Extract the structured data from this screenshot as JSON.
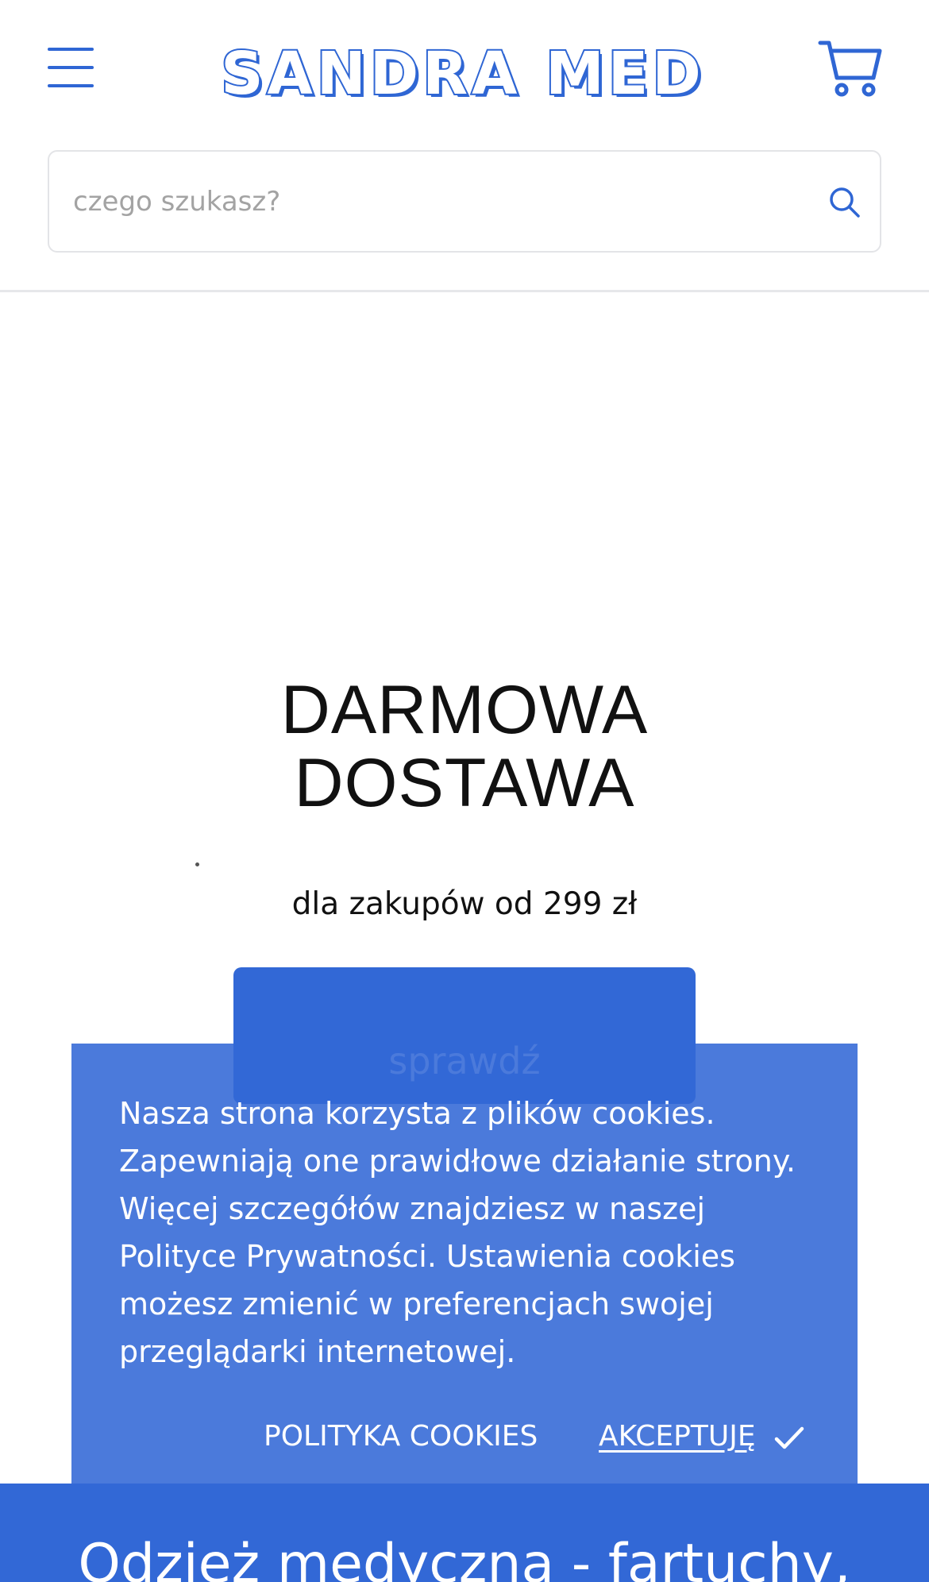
{
  "header": {
    "logo_text": "SANDRA MED",
    "menu_icon": "hamburger-menu-icon",
    "cart_icon": "shopping-cart-icon"
  },
  "search": {
    "placeholder": "czego szukasz?",
    "value": "",
    "icon": "search-icon"
  },
  "hero": {
    "title_line1": "DARMOWA",
    "title_line2": "DOSTAWA",
    "subtitle": "dla zakupów od 299 zł",
    "button_label": "sprawdź"
  },
  "cookie_banner": {
    "text": "Nasza strona korzysta z plików cookies. Zapewniają one prawidłowe działanie strony. Więcej szczegółów znajdziesz w naszej Polityce Prywatności. Ustawienia cookies możesz zmienić w preferencjach swojej przeglądarki internetowej.",
    "policy_label": "POLITYKA COOKIES",
    "accept_label": "AKCEPTUJĘ",
    "accept_icon": "check-icon"
  },
  "section": {
    "heading": "Odzież medyczna - fartuchy,"
  },
  "colors": {
    "brand_blue": "#3268d6",
    "banner_blue": "#4a7bdb",
    "text_dark": "#111111",
    "placeholder_gray": "#a3a3a3"
  }
}
